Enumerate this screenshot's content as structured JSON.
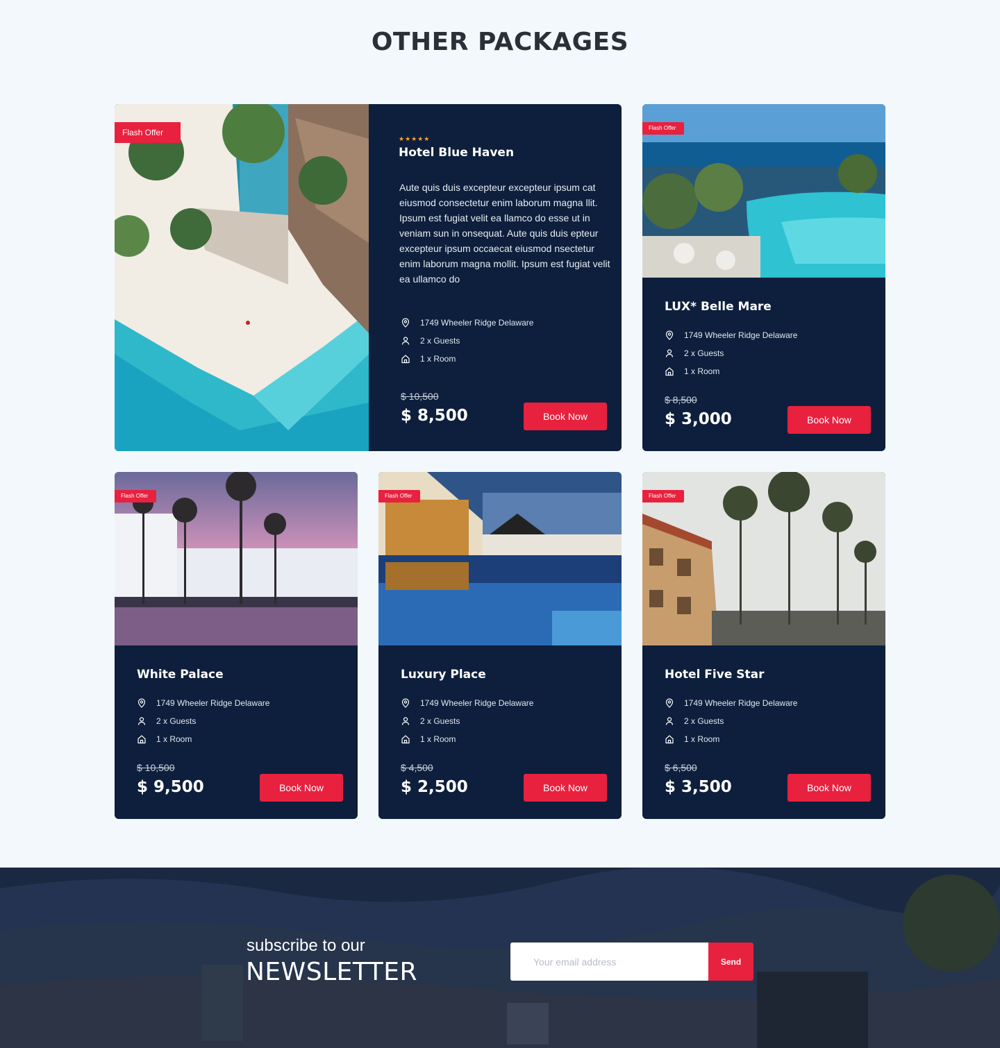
{
  "section_title": "OTHER PACKAGES",
  "flash_label": "Flash Offer",
  "book_label": "Book Now",
  "rating": "★★★★★",
  "featured": {
    "name": "Hotel Blue Haven",
    "description": "Aute quis duis excepteur excepteur ipsum cat eiusmod consectetur enim laborum magna llit. Ipsum est fugiat velit ea llamco do esse ut in veniam sun in onsequat. Aute quis duis epteur excepteur ipsum occaecat eiusmod nsectetur enim laborum magna mollit. Ipsum est fugiat velit ea ullamco do",
    "location": "1749 Wheeler Ridge  Delaware",
    "guests": "2 x Guests",
    "rooms": "1 x Room",
    "old_price": "$ 10,500",
    "price": "$ 8,500"
  },
  "cards": [
    {
      "name": "LUX* Belle Mare",
      "location": "1749 Wheeler Ridge  Delaware",
      "guests": "2 x Guests",
      "rooms": "1 x Room",
      "old_price": "$ 8,500",
      "price": "$ 3,000"
    },
    {
      "name": "White Palace",
      "location": "1749 Wheeler Ridge  Delaware",
      "guests": "2 x Guests",
      "rooms": "1 x Room",
      "old_price": "$ 10,500",
      "price": "$ 9,500"
    },
    {
      "name": "Luxury Place",
      "location": "1749 Wheeler Ridge  Delaware",
      "guests": "2 x Guests",
      "rooms": "1 x Room",
      "old_price": "$ 4,500",
      "price": "$ 2,500"
    },
    {
      "name": "Hotel Five Star",
      "location": "1749 Wheeler Ridge  Delaware",
      "guests": "2 x Guests",
      "rooms": "1 x Room",
      "old_price": "$ 6,500",
      "price": "$ 3,500"
    }
  ],
  "newsletter": {
    "subtitle": "subscribe to our",
    "title": "NEWSLETTER",
    "email_placeholder": "Your email address",
    "send_label": "Send"
  },
  "colors": {
    "card_bg": "#0d1f3c",
    "accent": "#e8213f",
    "page_bg": "#f3f8fd",
    "stars": "#f3a33a"
  }
}
